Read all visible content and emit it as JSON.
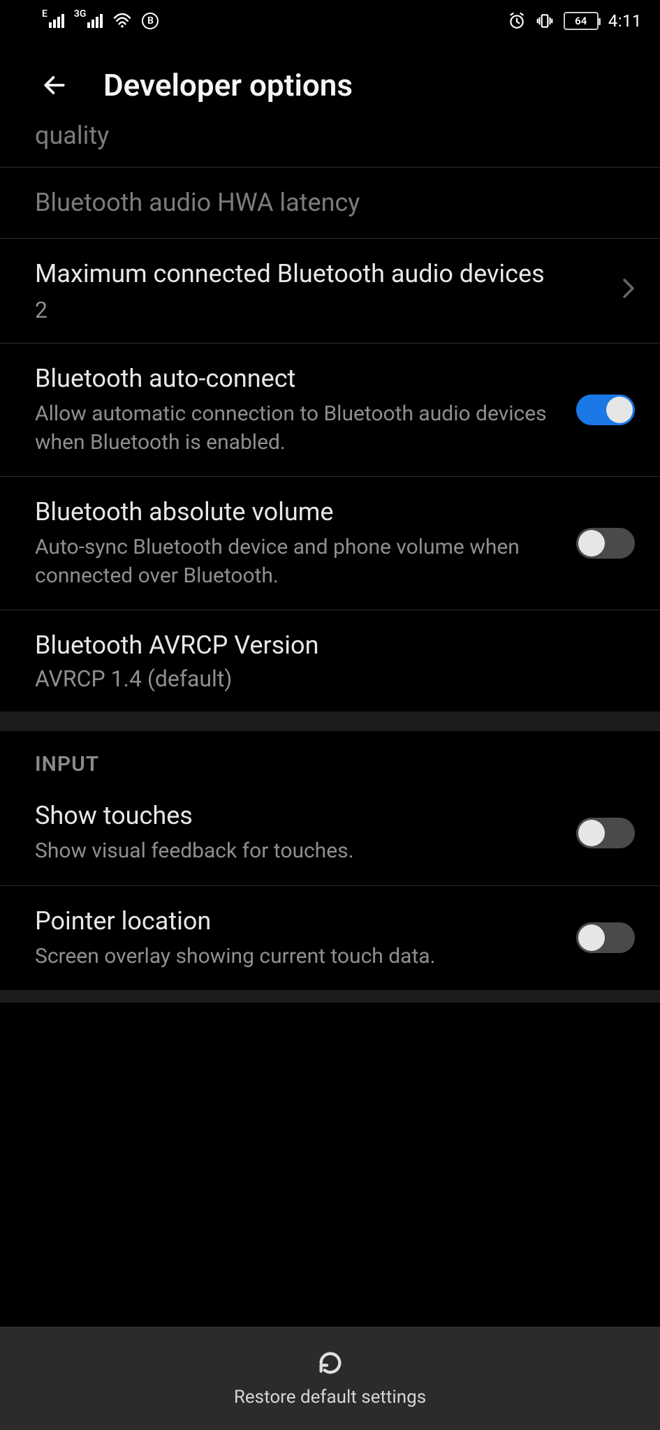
{
  "status": {
    "net1_type": "E",
    "net2_type": "3G",
    "circle_badge": "B",
    "battery": "64",
    "time": "4:11"
  },
  "header": {
    "title": "Developer options"
  },
  "items": {
    "quality": {
      "title": "quality"
    },
    "hwa": {
      "title": "Bluetooth audio HWA latency"
    },
    "maxdev": {
      "title": "Maximum connected Bluetooth audio devices",
      "value": "2"
    },
    "autoconnect": {
      "title": "Bluetooth auto-connect",
      "sub": "Allow automatic connection to Bluetooth audio devices when Bluetooth is enabled."
    },
    "absvol": {
      "title": "Bluetooth absolute volume",
      "sub": "Auto-sync Bluetooth device and phone volume when connected over Bluetooth."
    },
    "avrcp": {
      "title": "Bluetooth AVRCP Version",
      "value": "AVRCP 1.4 (default)"
    },
    "section_input": "INPUT",
    "touches": {
      "title": "Show touches",
      "sub": "Show visual feedback for touches."
    },
    "pointer": {
      "title": "Pointer location",
      "sub": "Screen overlay showing current touch data."
    }
  },
  "footer": {
    "restore": "Restore default settings"
  }
}
